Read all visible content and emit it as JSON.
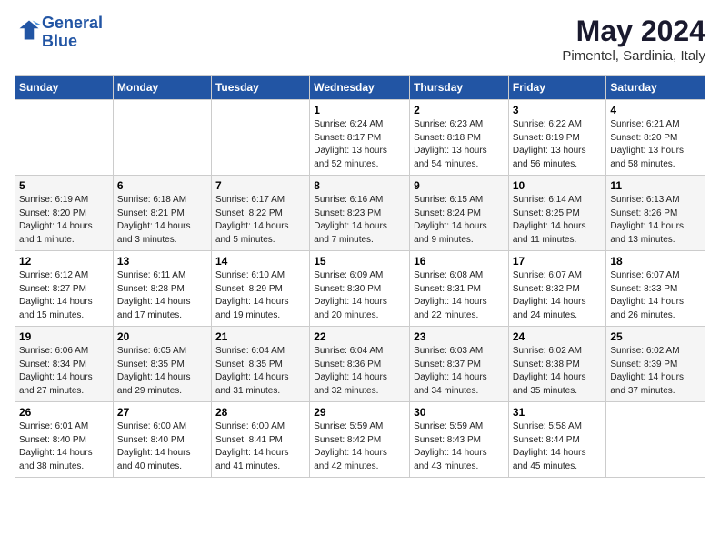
{
  "header": {
    "logo_line1": "General",
    "logo_line2": "Blue",
    "month": "May 2024",
    "location": "Pimentel, Sardinia, Italy"
  },
  "weekdays": [
    "Sunday",
    "Monday",
    "Tuesday",
    "Wednesday",
    "Thursday",
    "Friday",
    "Saturday"
  ],
  "weeks": [
    [
      {
        "day": "",
        "info": ""
      },
      {
        "day": "",
        "info": ""
      },
      {
        "day": "",
        "info": ""
      },
      {
        "day": "1",
        "info": "Sunrise: 6:24 AM\nSunset: 8:17 PM\nDaylight: 13 hours\nand 52 minutes."
      },
      {
        "day": "2",
        "info": "Sunrise: 6:23 AM\nSunset: 8:18 PM\nDaylight: 13 hours\nand 54 minutes."
      },
      {
        "day": "3",
        "info": "Sunrise: 6:22 AM\nSunset: 8:19 PM\nDaylight: 13 hours\nand 56 minutes."
      },
      {
        "day": "4",
        "info": "Sunrise: 6:21 AM\nSunset: 8:20 PM\nDaylight: 13 hours\nand 58 minutes."
      }
    ],
    [
      {
        "day": "5",
        "info": "Sunrise: 6:19 AM\nSunset: 8:20 PM\nDaylight: 14 hours\nand 1 minute."
      },
      {
        "day": "6",
        "info": "Sunrise: 6:18 AM\nSunset: 8:21 PM\nDaylight: 14 hours\nand 3 minutes."
      },
      {
        "day": "7",
        "info": "Sunrise: 6:17 AM\nSunset: 8:22 PM\nDaylight: 14 hours\nand 5 minutes."
      },
      {
        "day": "8",
        "info": "Sunrise: 6:16 AM\nSunset: 8:23 PM\nDaylight: 14 hours\nand 7 minutes."
      },
      {
        "day": "9",
        "info": "Sunrise: 6:15 AM\nSunset: 8:24 PM\nDaylight: 14 hours\nand 9 minutes."
      },
      {
        "day": "10",
        "info": "Sunrise: 6:14 AM\nSunset: 8:25 PM\nDaylight: 14 hours\nand 11 minutes."
      },
      {
        "day": "11",
        "info": "Sunrise: 6:13 AM\nSunset: 8:26 PM\nDaylight: 14 hours\nand 13 minutes."
      }
    ],
    [
      {
        "day": "12",
        "info": "Sunrise: 6:12 AM\nSunset: 8:27 PM\nDaylight: 14 hours\nand 15 minutes."
      },
      {
        "day": "13",
        "info": "Sunrise: 6:11 AM\nSunset: 8:28 PM\nDaylight: 14 hours\nand 17 minutes."
      },
      {
        "day": "14",
        "info": "Sunrise: 6:10 AM\nSunset: 8:29 PM\nDaylight: 14 hours\nand 19 minutes."
      },
      {
        "day": "15",
        "info": "Sunrise: 6:09 AM\nSunset: 8:30 PM\nDaylight: 14 hours\nand 20 minutes."
      },
      {
        "day": "16",
        "info": "Sunrise: 6:08 AM\nSunset: 8:31 PM\nDaylight: 14 hours\nand 22 minutes."
      },
      {
        "day": "17",
        "info": "Sunrise: 6:07 AM\nSunset: 8:32 PM\nDaylight: 14 hours\nand 24 minutes."
      },
      {
        "day": "18",
        "info": "Sunrise: 6:07 AM\nSunset: 8:33 PM\nDaylight: 14 hours\nand 26 minutes."
      }
    ],
    [
      {
        "day": "19",
        "info": "Sunrise: 6:06 AM\nSunset: 8:34 PM\nDaylight: 14 hours\nand 27 minutes."
      },
      {
        "day": "20",
        "info": "Sunrise: 6:05 AM\nSunset: 8:35 PM\nDaylight: 14 hours\nand 29 minutes."
      },
      {
        "day": "21",
        "info": "Sunrise: 6:04 AM\nSunset: 8:35 PM\nDaylight: 14 hours\nand 31 minutes."
      },
      {
        "day": "22",
        "info": "Sunrise: 6:04 AM\nSunset: 8:36 PM\nDaylight: 14 hours\nand 32 minutes."
      },
      {
        "day": "23",
        "info": "Sunrise: 6:03 AM\nSunset: 8:37 PM\nDaylight: 14 hours\nand 34 minutes."
      },
      {
        "day": "24",
        "info": "Sunrise: 6:02 AM\nSunset: 8:38 PM\nDaylight: 14 hours\nand 35 minutes."
      },
      {
        "day": "25",
        "info": "Sunrise: 6:02 AM\nSunset: 8:39 PM\nDaylight: 14 hours\nand 37 minutes."
      }
    ],
    [
      {
        "day": "26",
        "info": "Sunrise: 6:01 AM\nSunset: 8:40 PM\nDaylight: 14 hours\nand 38 minutes."
      },
      {
        "day": "27",
        "info": "Sunrise: 6:00 AM\nSunset: 8:40 PM\nDaylight: 14 hours\nand 40 minutes."
      },
      {
        "day": "28",
        "info": "Sunrise: 6:00 AM\nSunset: 8:41 PM\nDaylight: 14 hours\nand 41 minutes."
      },
      {
        "day": "29",
        "info": "Sunrise: 5:59 AM\nSunset: 8:42 PM\nDaylight: 14 hours\nand 42 minutes."
      },
      {
        "day": "30",
        "info": "Sunrise: 5:59 AM\nSunset: 8:43 PM\nDaylight: 14 hours\nand 43 minutes."
      },
      {
        "day": "31",
        "info": "Sunrise: 5:58 AM\nSunset: 8:44 PM\nDaylight: 14 hours\nand 45 minutes."
      },
      {
        "day": "",
        "info": ""
      }
    ]
  ]
}
